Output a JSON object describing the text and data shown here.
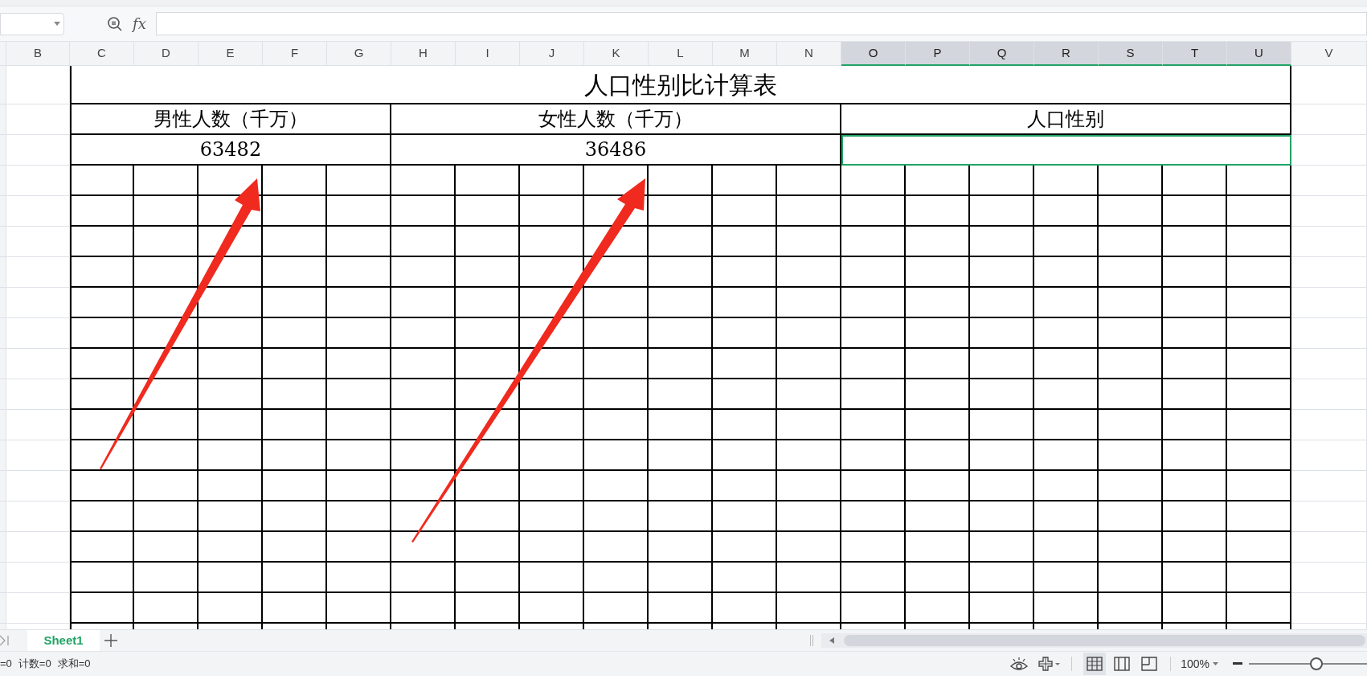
{
  "formula_bar": {
    "function_label": "fx"
  },
  "columns": [
    {
      "label": "B",
      "selected": false
    },
    {
      "label": "C",
      "selected": false
    },
    {
      "label": "D",
      "selected": false
    },
    {
      "label": "E",
      "selected": false
    },
    {
      "label": "F",
      "selected": false
    },
    {
      "label": "G",
      "selected": false
    },
    {
      "label": "H",
      "selected": false
    },
    {
      "label": "I",
      "selected": false
    },
    {
      "label": "J",
      "selected": false
    },
    {
      "label": "K",
      "selected": false
    },
    {
      "label": "L",
      "selected": false
    },
    {
      "label": "M",
      "selected": false
    },
    {
      "label": "N",
      "selected": false
    },
    {
      "label": "O",
      "selected": true
    },
    {
      "label": "P",
      "selected": true
    },
    {
      "label": "Q",
      "selected": true
    },
    {
      "label": "R",
      "selected": true
    },
    {
      "label": "S",
      "selected": true
    },
    {
      "label": "T",
      "selected": true
    },
    {
      "label": "U",
      "selected": true
    },
    {
      "label": "V",
      "selected": false
    }
  ],
  "table": {
    "title": "人口性别比计算表",
    "groups": [
      {
        "header": "男性人数（千万）",
        "value": "63482",
        "selected": false
      },
      {
        "header": "女性人数（千万）",
        "value": "36486",
        "selected": false
      },
      {
        "header": "人口性别",
        "selected": true
      }
    ]
  },
  "sheet_tabs": [
    {
      "label": "Sheet1",
      "selected": true
    }
  ],
  "status_bar": {
    "stats": [
      "=0",
      "计数=0",
      "求和=0"
    ],
    "zoom": "100%",
    "zoom_level": {
      "level": 0.57
    },
    "views": [
      {
        "kind": "normal",
        "selected": true
      },
      {
        "kind": "layout",
        "selected": false
      },
      {
        "kind": "break",
        "selected": false
      }
    ]
  }
}
